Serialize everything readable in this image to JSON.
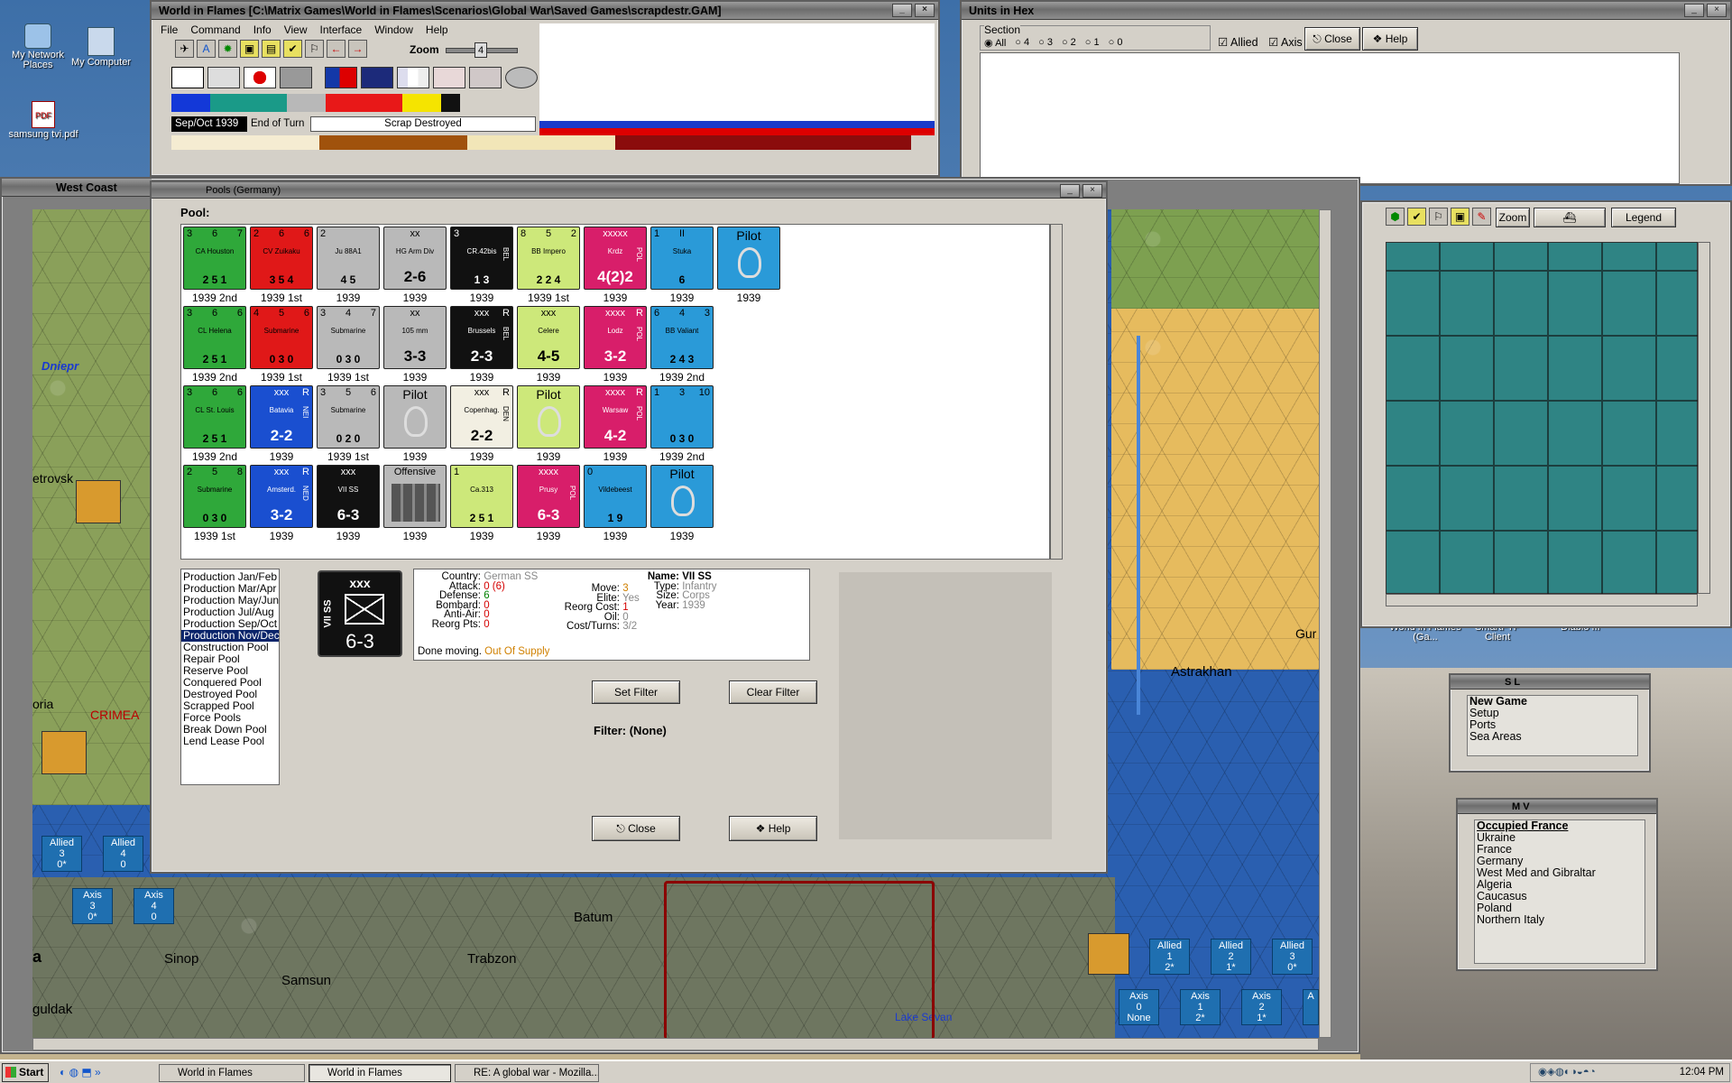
{
  "desktop": {
    "icons": [
      {
        "label": "My Network Places"
      },
      {
        "label": "My Computer"
      },
      {
        "label": "samsung tvi.pdf"
      },
      {
        "label": "World in Flames (Ga..."
      },
      {
        "label": "SmartFTP Client"
      },
      {
        "label": "Diablo III"
      }
    ]
  },
  "main_window": {
    "title": "World in Flames [C:\\Matrix Games\\World in Flames\\Scenarios\\Global War\\Saved Games\\scrapdestr.GAM]",
    "menu": [
      "File",
      "Command",
      "Info",
      "View",
      "Interface",
      "Window",
      "Help"
    ],
    "zoom_label": "Zoom",
    "zoom_value": "4",
    "date": "Sep/Oct 1939",
    "phase": "End of Turn",
    "status": "Scrap Destroyed"
  },
  "units_window": {
    "title": "Units in Hex",
    "section_label": "Section",
    "radio_options": [
      "All",
      "4",
      "3",
      "2",
      "1",
      "0"
    ],
    "allied_label": "Allied",
    "axis_label": "Axis",
    "close_label": "Close",
    "help_label": "Help"
  },
  "west_coast": {
    "title": "West Coast",
    "places": [
      "Dniepr",
      "etrovsk",
      "oria",
      "CRIMEA",
      "Sinop",
      "Samsun",
      "Trabzon",
      "Batum",
      "guldak",
      "a",
      "Lake Sevan",
      "Astrakhan",
      "Gur"
    ],
    "stacks": [
      {
        "side": "Allied",
        "section": "3",
        "count": "0*"
      },
      {
        "side": "Allied",
        "section": "4",
        "count": "0"
      },
      {
        "side": "Axis",
        "section": "3",
        "count": "0*"
      },
      {
        "side": "Axis",
        "section": "4",
        "count": "0"
      },
      {
        "side": "Allied",
        "section": "1",
        "count": "2*"
      },
      {
        "side": "Allied",
        "section": "2",
        "count": "1*"
      },
      {
        "side": "Allied",
        "section": "3",
        "count": "0*"
      },
      {
        "side": "Axis",
        "section": "0",
        "count": "None"
      },
      {
        "side": "Axis",
        "section": "1",
        "count": "2*"
      },
      {
        "side": "Axis",
        "section": "2",
        "count": "1*"
      },
      {
        "side": "A",
        "section": "",
        "count": ""
      }
    ]
  },
  "pools_window": {
    "title": "Pools (Germany)",
    "pool_label": "Pool:",
    "units": [
      {
        "name": "CA Houston",
        "top": [
          "3",
          "6",
          "7"
        ],
        "bottom": [
          "2",
          "5",
          "1"
        ],
        "year": "1939 2nd",
        "color": "#2fa83a",
        "kind": "ship"
      },
      {
        "name": "CV Zuikaku",
        "top": [
          "2",
          "6",
          "6"
        ],
        "bottom": [
          "3",
          "5",
          "4"
        ],
        "year": "1939 1st",
        "color": "#e01818",
        "kind": "ship"
      },
      {
        "name": "Ju 88A1",
        "top": [
          "2",
          "",
          ""
        ],
        "bottom": [
          "4",
          "5",
          ""
        ],
        "year": "1939",
        "color": "#b9b9b9",
        "kind": "air"
      },
      {
        "name": "HG Arm Div",
        "top": [
          "",
          "xx",
          ""
        ],
        "bottom": [
          "2-6",
          "",
          ""
        ],
        "year": "1939",
        "color": "#b9b9b9",
        "kind": "armor"
      },
      {
        "name": "CR.42bis",
        "top": [
          "3",
          "",
          ""
        ],
        "bottom": [
          "1",
          "3",
          ""
        ],
        "year": "1939",
        "color": "#111111",
        "kind": "air",
        "tag": "BEL"
      },
      {
        "name": "BB Impero",
        "top": [
          "8",
          "5",
          "2"
        ],
        "bottom": [
          "2",
          "2",
          "4"
        ],
        "year": "1939 1st",
        "color": "#cde87a",
        "kind": "ship"
      },
      {
        "name": "Krdz",
        "top": [
          "",
          "xxxxx",
          ""
        ],
        "bottom": [
          "4(2)2",
          "",
          ""
        ],
        "year": "1939",
        "color": "#d81e6a",
        "kind": "inf",
        "tag": "POL"
      },
      {
        "name": "Stuka",
        "top": [
          "1",
          "II",
          ""
        ],
        "bottom": [
          "",
          "6",
          ""
        ],
        "year": "1939",
        "color": "#2a9ad8",
        "kind": "air"
      },
      {
        "name": "Pilot",
        "top": [
          "",
          "",
          ""
        ],
        "bottom": [
          "",
          "",
          ""
        ],
        "year": "1939",
        "color": "#2a9ad8",
        "kind": "pilot"
      },
      {
        "name": "CL Helena",
        "top": [
          "3",
          "6",
          "6"
        ],
        "bottom": [
          "2",
          "5",
          "1"
        ],
        "year": "1939 2nd",
        "color": "#2fa83a",
        "kind": "ship"
      },
      {
        "name": "Submarine",
        "top": [
          "4",
          "5",
          "6"
        ],
        "bottom": [
          "0",
          "3",
          "0"
        ],
        "year": "1939 1st",
        "color": "#e01818",
        "kind": "sub"
      },
      {
        "name": "Submarine",
        "top": [
          "3",
          "4",
          "7"
        ],
        "bottom": [
          "0",
          "3",
          "0"
        ],
        "year": "1939 1st",
        "color": "#b9b9b9",
        "kind": "sub"
      },
      {
        "name": "105 mm",
        "top": [
          "",
          "xx",
          ""
        ],
        "bottom": [
          "3-3",
          "",
          ""
        ],
        "year": "1939",
        "color": "#b9b9b9",
        "kind": "art"
      },
      {
        "name": "Brussels",
        "top": [
          "",
          "xxx",
          "R"
        ],
        "bottom": [
          "2-3",
          "",
          ""
        ],
        "year": "1939",
        "color": "#111111",
        "kind": "inf",
        "tag": "BEL"
      },
      {
        "name": "Celere",
        "top": [
          "",
          "xxx",
          ""
        ],
        "bottom": [
          "4-5",
          "",
          ""
        ],
        "year": "1939",
        "color": "#cde87a",
        "kind": "cav"
      },
      {
        "name": "Lodz",
        "top": [
          "",
          "xxxx",
          "R"
        ],
        "bottom": [
          "3-2",
          "",
          ""
        ],
        "year": "1939",
        "color": "#d81e6a",
        "kind": "inf",
        "tag": "POL"
      },
      {
        "name": "BB Valiant",
        "top": [
          "6",
          "4",
          "3"
        ],
        "bottom": [
          "2",
          "4",
          "3"
        ],
        "year": "1939 2nd",
        "color": "#2a9ad8",
        "kind": "ship"
      },
      {
        "name": "CL St. Louis",
        "top": [
          "3",
          "6",
          "6"
        ],
        "bottom": [
          "2",
          "5",
          "1"
        ],
        "year": "1939 2nd",
        "color": "#2fa83a",
        "kind": "ship"
      },
      {
        "name": "Batavia",
        "top": [
          "",
          "xxx",
          "R"
        ],
        "bottom": [
          "2-2",
          "",
          ""
        ],
        "year": "1939",
        "color": "#1a4fd0",
        "kind": "inf",
        "tag": "NEI"
      },
      {
        "name": "Submarine",
        "top": [
          "3",
          "5",
          "6"
        ],
        "bottom": [
          "0",
          "2",
          "0"
        ],
        "year": "1939 1st",
        "color": "#b9b9b9",
        "kind": "sub"
      },
      {
        "name": "Pilot",
        "top": [
          "",
          "",
          ""
        ],
        "bottom": [
          "",
          "",
          ""
        ],
        "year": "1939",
        "color": "#b9b9b9",
        "kind": "pilot"
      },
      {
        "name": "Copenhag.",
        "top": [
          "",
          "xxx",
          "R"
        ],
        "bottom": [
          "2-2",
          "",
          ""
        ],
        "year": "1939",
        "color": "#f2efe2",
        "kind": "inf",
        "tag": "DEN"
      },
      {
        "name": "Pilot",
        "top": [
          "",
          "",
          ""
        ],
        "bottom": [
          "",
          "",
          ""
        ],
        "year": "1939",
        "color": "#cde87a",
        "kind": "pilot"
      },
      {
        "name": "Warsaw",
        "top": [
          "",
          "xxxx",
          "R"
        ],
        "bottom": [
          "4-2",
          "",
          ""
        ],
        "year": "1939",
        "color": "#d81e6a",
        "kind": "inf",
        "tag": "POL"
      },
      {
        "name": "",
        "top": [
          "1",
          "3",
          "10"
        ],
        "bottom": [
          "0",
          "3",
          "0"
        ],
        "year": "1939 2nd",
        "color": "#2a9ad8",
        "kind": "ship"
      },
      {
        "name": "Submarine",
        "top": [
          "2",
          "5",
          "8"
        ],
        "bottom": [
          "0",
          "3",
          "0"
        ],
        "year": "1939 1st",
        "color": "#2fa83a",
        "kind": "sub"
      },
      {
        "name": "Amsterd.",
        "top": [
          "",
          "xxx",
          "R"
        ],
        "bottom": [
          "3-2",
          "",
          ""
        ],
        "year": "1939",
        "color": "#1a4fd0",
        "kind": "inf",
        "tag": "NED"
      },
      {
        "name": "VII SS",
        "top": [
          "",
          "xxx",
          ""
        ],
        "bottom": [
          "6-3",
          "",
          ""
        ],
        "year": "1939",
        "color": "#111111",
        "kind": "inf"
      },
      {
        "name": "Offensive",
        "top": [
          "",
          "",
          ""
        ],
        "bottom": [
          "",
          "",
          ""
        ],
        "year": "1939",
        "color": "#b9b9b9",
        "kind": "oil"
      },
      {
        "name": "Ca.313",
        "top": [
          "1",
          "",
          ""
        ],
        "bottom": [
          "2",
          "5",
          "1"
        ],
        "year": "1939",
        "color": "#cde87a",
        "kind": "air"
      },
      {
        "name": "Prusy",
        "top": [
          "",
          "xxxx",
          ""
        ],
        "bottom": [
          "6-3",
          "",
          ""
        ],
        "year": "1939",
        "color": "#d81e6a",
        "kind": "inf",
        "tag": "POL"
      },
      {
        "name": "Vildebeest",
        "top": [
          "0",
          "",
          ""
        ],
        "bottom": [
          "1",
          "9",
          ""
        ],
        "year": "1939",
        "color": "#2a9ad8",
        "kind": "air"
      },
      {
        "name": "Pilot",
        "top": [
          "",
          "",
          ""
        ],
        "bottom": [
          "",
          "",
          ""
        ],
        "year": "1939",
        "color": "#2a9ad8",
        "kind": "pilot"
      }
    ],
    "pool_list": [
      "Production Jan/Feb",
      "Production Mar/Apr",
      "Production May/Jun",
      "Production Jul/Aug",
      "Production Sep/Oct",
      "Production Nov/Dec",
      "Construction Pool",
      "Repair Pool",
      "Reserve Pool",
      "Conquered Pool",
      "Destroyed Pool",
      "Scrapped Pool",
      "Force Pools",
      "Break Down Pool",
      "Lend Lease Pool"
    ],
    "selected_pool": "Production Nov/Dec",
    "selected_unit": {
      "side_label": "VII SS",
      "size": "xxx",
      "strength": "6-3"
    },
    "details": {
      "country_label": "Country:",
      "country": "German SS",
      "attack_label": "Attack:",
      "attack": "0 (6)",
      "defense_label": "Defense:",
      "defense": "6",
      "bombard_label": "Bombard:",
      "bombard": "0",
      "antiair_label": "Anti-Air:",
      "antiair": "0",
      "reorg_label": "Reorg Pts:",
      "reorg": "0",
      "move_label": "Move:",
      "move": "3",
      "elite_label": "Elite:",
      "elite": "Yes",
      "reorgcost_label": "Reorg Cost:",
      "reorgcost": "1",
      "oil_label": "Oil:",
      "oil": "0",
      "cost_label": "Cost/Turns:",
      "cost": "3/2",
      "name_label": "Name:",
      "name": "VII SS",
      "type_label": "Type:",
      "type": "Infantry",
      "size_label": "Size:",
      "size": "Corps",
      "year_label": "Year:",
      "year": "1939",
      "done_label": "Done moving.",
      "supply": "Out Of Supply"
    },
    "set_filter": "Set Filter",
    "clear_filter": "Clear Filter",
    "filter_text": "Filter: (None)",
    "close_label": "Close",
    "help_label": "Help"
  },
  "overview": {
    "zoom_label": "Zoom",
    "legend_label": "Legend"
  },
  "sl_window": {
    "title": "S L",
    "items": [
      "New Game",
      "Setup",
      "Ports",
      "Sea Areas"
    ]
  },
  "mv_window": {
    "title": "M V",
    "items": [
      "Occupied France",
      "Ukraine",
      "France",
      "Germany",
      "West Med and Gibraltar",
      "Algeria",
      "Caucasus",
      "Poland",
      "Northern Italy"
    ]
  },
  "taskbar": {
    "start": "Start",
    "tasks": [
      "World in Flames",
      "World in Flames",
      "RE: A global war - Mozilla..."
    ],
    "clock": "12:04 PM"
  },
  "colors": {
    "accent": "#0a246a",
    "ally_stack": "#1f6fb0"
  }
}
